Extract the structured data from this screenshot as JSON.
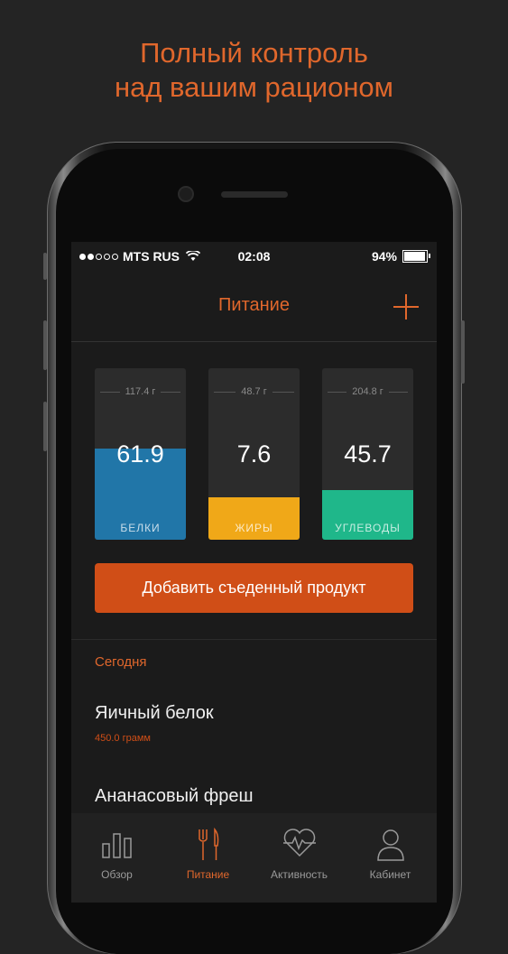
{
  "promo": {
    "line1": "Полный контроль",
    "line2": "над вашим рационом"
  },
  "status_bar": {
    "carrier": "MTS RUS",
    "signal_filled": 2,
    "signal_total": 5,
    "time": "02:08",
    "battery": "94%",
    "battery_level": 0.94
  },
  "nav": {
    "title": "Питание",
    "add_icon": "plus-icon"
  },
  "colors": {
    "accent": "#e0672c",
    "button": "#d04e17",
    "protein": "#2176a8",
    "fat": "#f0a818",
    "carbs": "#1fb78a"
  },
  "macros": [
    {
      "name": "БЕЛКИ",
      "value": "61.9",
      "limit": "117.4 г",
      "fill_fraction": 0.53,
      "color": "#2176a8"
    },
    {
      "name": "ЖИРЫ",
      "value": "7.6",
      "limit": "48.7 г",
      "fill_fraction": 0.25,
      "color": "#f0a818"
    },
    {
      "name": "УГЛЕВОДЫ",
      "value": "45.7",
      "limit": "204.8 г",
      "fill_fraction": 0.29,
      "color": "#1fb78a"
    }
  ],
  "add_button_label": "Добавить съеденный продукт",
  "section_today": "Сегодня",
  "food_items": [
    {
      "name": "Яичный белок",
      "amount": "450.0 грамм"
    },
    {
      "name": "Ананасовый фреш",
      "amount": ""
    }
  ],
  "tabs": [
    {
      "label": "Обзор",
      "icon": "bar-chart-icon",
      "active": false
    },
    {
      "label": "Питание",
      "icon": "fork-knife-icon",
      "active": true
    },
    {
      "label": "Активность",
      "icon": "heart-pulse-icon",
      "active": false
    },
    {
      "label": "Кабинет",
      "icon": "user-icon",
      "active": false
    }
  ]
}
